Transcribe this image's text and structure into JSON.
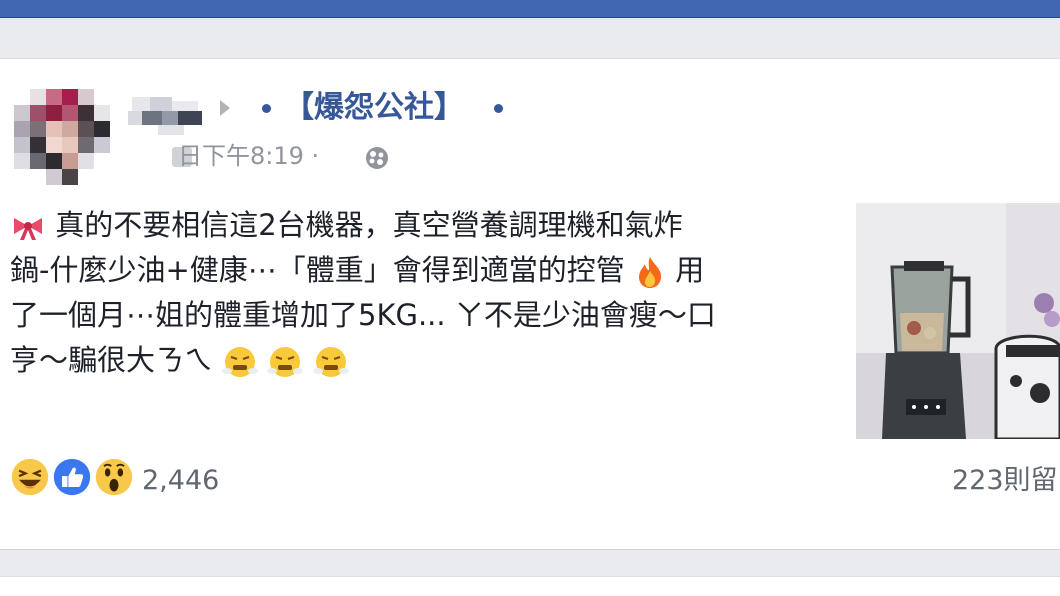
{
  "group": {
    "name": "【爆怨公社】"
  },
  "post": {
    "timestamp": "日下午8:19 ·",
    "lines": [
      "真的不要相信這2台機器，真空營養調理機和氣炸",
      "鍋-什麼少油+健康⋯「體重」會得到適當的控管",
      "用",
      "了一個月⋯姐的體重增加了5KG... ㄚ不是少油會瘦～口",
      "亨～騙很大ㄋㄟ"
    ],
    "icons": [
      "ribbon-bow-emoji",
      "fire-emoji",
      "steaming-angry-emoji"
    ],
    "photo_alt": "blender and air fryer on counter"
  },
  "footer": {
    "reaction_count": "2,446",
    "comment_count": "223則留",
    "reaction_icons": [
      "haha-icon",
      "like-icon",
      "wow-icon"
    ]
  },
  "colors": {
    "brand_blue": "#4267b2",
    "link_blue": "#365899",
    "text": "#1d2129",
    "muted": "#90949c"
  }
}
